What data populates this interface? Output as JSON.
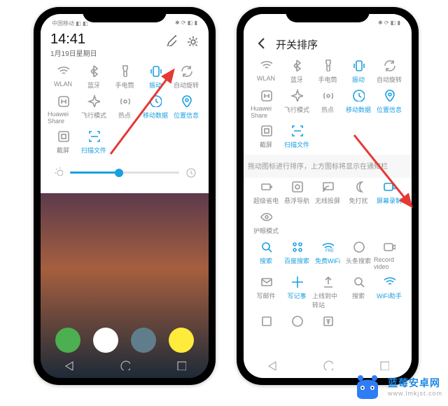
{
  "left": {
    "status": {
      "time": "14:41",
      "date": "1月19日星期日"
    },
    "hdr_icons": {
      "edit": "edit-icon",
      "settings": "settings-icon"
    },
    "tiles_row1": [
      {
        "label": "WLAN",
        "icon": "wifi",
        "active": false
      },
      {
        "label": "蓝牙",
        "icon": "bluetooth",
        "active": false
      },
      {
        "label": "手电筒",
        "icon": "torch",
        "active": false
      },
      {
        "label": "振动",
        "icon": "vibrate",
        "active": true
      },
      {
        "label": "自动旋转",
        "icon": "rotate",
        "active": false
      }
    ],
    "tiles_row2": [
      {
        "label": "Huawei Share",
        "icon": "hshare",
        "active": false
      },
      {
        "label": "飞行模式",
        "icon": "plane",
        "active": false
      },
      {
        "label": "热点",
        "icon": "hotspot",
        "active": false
      },
      {
        "label": "移动数据",
        "icon": "data",
        "active": true
      },
      {
        "label": "位置信息",
        "icon": "location",
        "active": true
      }
    ],
    "tiles_row3": [
      {
        "label": "截屏",
        "icon": "screenshot",
        "active": false
      },
      {
        "label": "扫描文件",
        "icon": "scan",
        "active": true
      }
    ],
    "slider": {
      "value": 45
    }
  },
  "right": {
    "header": {
      "back": "back-icon",
      "title": "开关排序"
    },
    "tiles_row1": [
      {
        "label": "WLAN",
        "icon": "wifi",
        "active": false
      },
      {
        "label": "蓝牙",
        "icon": "bluetooth",
        "active": false
      },
      {
        "label": "手电筒",
        "icon": "torch",
        "active": false
      },
      {
        "label": "振动",
        "icon": "vibrate",
        "active": true
      },
      {
        "label": "自动旋转",
        "icon": "rotate",
        "active": false
      }
    ],
    "tiles_row2": [
      {
        "label": "Huawei Share",
        "icon": "hshare",
        "active": false
      },
      {
        "label": "飞行模式",
        "icon": "plane",
        "active": false
      },
      {
        "label": "热点",
        "icon": "hotspot",
        "active": false
      },
      {
        "label": "移动数据",
        "icon": "data",
        "active": true
      },
      {
        "label": "位置信息",
        "icon": "location",
        "active": true
      }
    ],
    "tiles_row3": [
      {
        "label": "截屏",
        "icon": "screenshot",
        "active": false
      },
      {
        "label": "扫描文件",
        "icon": "scan",
        "active": true
      }
    ],
    "hint": "拖动图标进行排序，上方图标将显示在通知栏",
    "tiles_row4": [
      {
        "label": "超级省电",
        "icon": "battery",
        "active": false
      },
      {
        "label": "悬浮导航",
        "icon": "floatnav",
        "active": false
      },
      {
        "label": "无线投屏",
        "icon": "cast",
        "active": false
      },
      {
        "label": "免打扰",
        "icon": "dnd",
        "active": false
      },
      {
        "label": "屏幕录制",
        "icon": "record",
        "active": true
      }
    ],
    "tiles_row5": [
      {
        "label": "护眼模式",
        "icon": "eye",
        "active": false
      }
    ],
    "tiles_row6": [
      {
        "label": "搜索",
        "icon": "search",
        "active": true,
        "accented": true
      },
      {
        "label": "百度搜索",
        "icon": "baidu",
        "active": true,
        "accented": true
      },
      {
        "label": "免费WiFi",
        "icon": "freewifi",
        "active": true,
        "accented": true
      },
      {
        "label": "头条搜索",
        "icon": "toutiao",
        "active": false
      },
      {
        "label": "Record video",
        "icon": "rec2",
        "active": false
      }
    ],
    "tiles_row7": [
      {
        "label": "写邮件",
        "icon": "mail",
        "active": false
      },
      {
        "label": "写记事",
        "icon": "note",
        "active": true,
        "accented": true
      },
      {
        "label": "上线到中转站",
        "icon": "upload",
        "active": false
      },
      {
        "label": "搜索",
        "icon": "search2",
        "active": false
      },
      {
        "label": "WiFi助手",
        "icon": "wifihelper",
        "active": true,
        "accented": true
      }
    ],
    "tiles_row8": [
      {
        "label": "",
        "icon": "box",
        "active": false
      },
      {
        "label": "",
        "icon": "circle",
        "active": false
      },
      {
        "label": "",
        "icon": "money",
        "active": false
      }
    ]
  },
  "watermark": {
    "name": "蓝莓安卓网",
    "url": "www.lmkjst.com"
  },
  "arrows": {
    "left": "red-arrow-downleft",
    "right": "red-arrow-downleft"
  }
}
